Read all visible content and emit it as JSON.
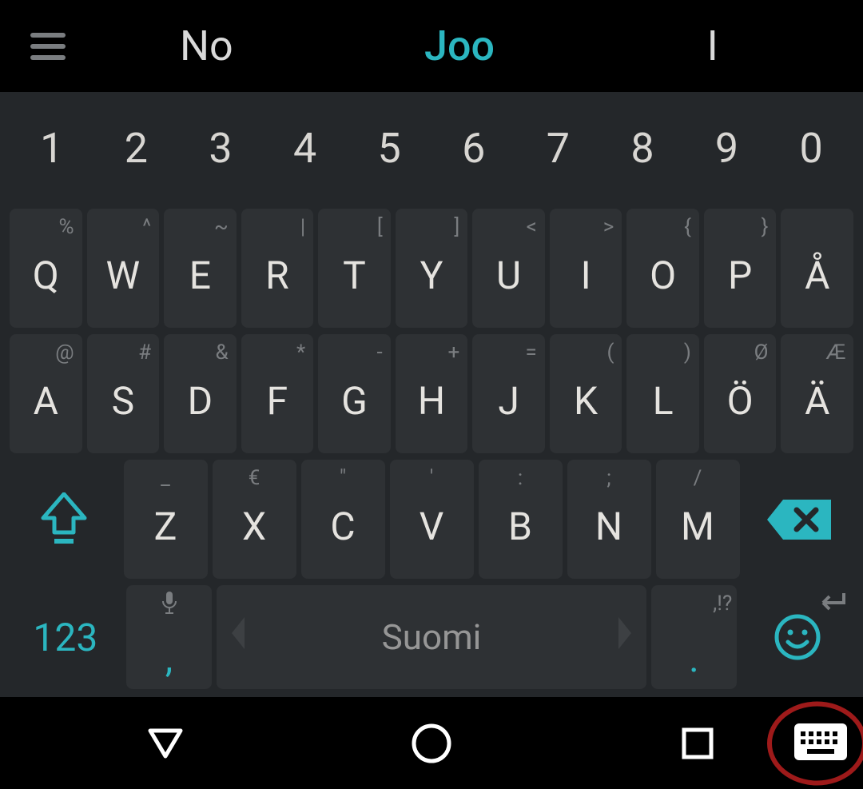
{
  "suggestions": {
    "s1": "No",
    "s2": "Joo",
    "s3": "I"
  },
  "numbers": [
    "1",
    "2",
    "3",
    "4",
    "5",
    "6",
    "7",
    "8",
    "9",
    "0"
  ],
  "row1": [
    {
      "main": "Q",
      "sec": "%"
    },
    {
      "main": "W",
      "sec": "^"
    },
    {
      "main": "E",
      "sec": "~"
    },
    {
      "main": "R",
      "sec": "|"
    },
    {
      "main": "T",
      "sec": "["
    },
    {
      "main": "Y",
      "sec": "]"
    },
    {
      "main": "U",
      "sec": "<"
    },
    {
      "main": "I",
      "sec": ">"
    },
    {
      "main": "O",
      "sec": "{"
    },
    {
      "main": "P",
      "sec": "}"
    },
    {
      "main": "Å",
      "sec": ""
    }
  ],
  "row2": [
    {
      "main": "A",
      "sec": "@"
    },
    {
      "main": "S",
      "sec": "#"
    },
    {
      "main": "D",
      "sec": "&"
    },
    {
      "main": "F",
      "sec": "*"
    },
    {
      "main": "G",
      "sec": "-"
    },
    {
      "main": "H",
      "sec": "+"
    },
    {
      "main": "J",
      "sec": "="
    },
    {
      "main": "K",
      "sec": "("
    },
    {
      "main": "L",
      "sec": ")"
    },
    {
      "main": "Ö",
      "sec": "Ø"
    },
    {
      "main": "Ä",
      "sec": "Æ"
    }
  ],
  "row3": [
    {
      "main": "Z",
      "sec": "_"
    },
    {
      "main": "X",
      "sec": "€"
    },
    {
      "main": "C",
      "sec": "\""
    },
    {
      "main": "V",
      "sec": "'"
    },
    {
      "main": "B",
      "sec": ":"
    },
    {
      "main": "N",
      "sec": ";"
    },
    {
      "main": "M",
      "sec": "/"
    }
  ],
  "bottom": {
    "sym": "123",
    "comma": ",",
    "space": "Suomi",
    "period": ".",
    "period_sec": ",!?"
  }
}
